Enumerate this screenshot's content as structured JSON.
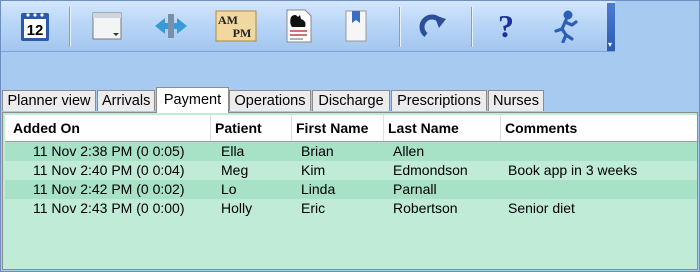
{
  "toolbar": {
    "buttons": [
      {
        "name": "calendar-icon",
        "label": "12"
      },
      {
        "name": "window-dropdown-icon",
        "label": ""
      },
      {
        "name": "swap-arrows-icon",
        "label": ""
      },
      {
        "name": "ampm-icon",
        "label_top": "AM",
        "label_bottom": "PM"
      },
      {
        "name": "report-icon",
        "label": ""
      },
      {
        "name": "bookmark-icon",
        "label": ""
      },
      {
        "name": "redo-icon",
        "label": ""
      },
      {
        "name": "help-icon",
        "label": "?"
      },
      {
        "name": "run-icon",
        "label": ""
      }
    ]
  },
  "tabs": [
    {
      "label": "Planner view"
    },
    {
      "label": "Arrivals"
    },
    {
      "label": "Payment",
      "active": true
    },
    {
      "label": "Operations"
    },
    {
      "label": "Discharge"
    },
    {
      "label": "Prescriptions"
    },
    {
      "label": "Nurses"
    }
  ],
  "table": {
    "columns": [
      "Added On",
      "Patient",
      "First Name",
      "Last Name",
      "Comments"
    ],
    "rows": [
      [
        "11 Nov 2:38 PM (0 0:05)",
        "Ella",
        "Brian",
        "Allen",
        ""
      ],
      [
        "11 Nov 2:40 PM (0 0:04)",
        "Meg",
        "Kim",
        "Edmondson",
        "Book app in 3 weeks"
      ],
      [
        "11 Nov 2:42 PM (0 0:02)",
        "Lo",
        "Linda",
        "Parnall",
        ""
      ],
      [
        "11 Nov 2:43 PM (0 0:00)",
        "Holly",
        "Eric",
        "Robertson",
        "Senior diet"
      ]
    ]
  },
  "colors": {
    "app_background": "#a6caf0",
    "table_row": "#c0ebd6",
    "table_row_alt": "#a7e1c6"
  }
}
